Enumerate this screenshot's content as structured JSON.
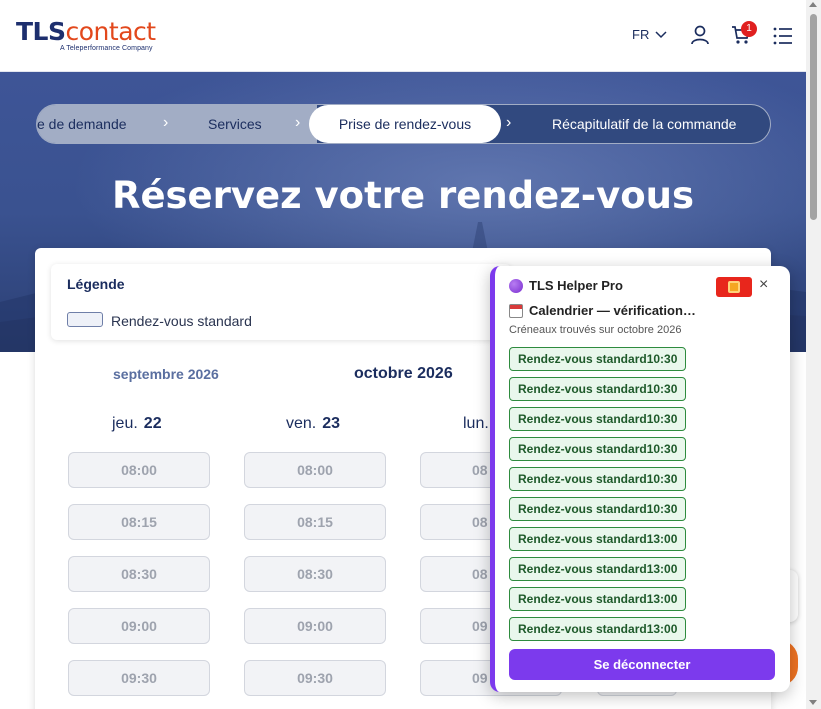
{
  "header": {
    "logo_tls": "TLS",
    "logo_contact": "contact",
    "logo_sub": "A Teleperformance Company",
    "language": "FR",
    "cart_count": "1"
  },
  "steps": {
    "items": [
      "e de demande",
      "Services",
      "Prise de rendez-vous",
      "Récapitulatif de la commande"
    ],
    "separator": "›",
    "active_index": 2
  },
  "hero": {
    "title": "Réservez votre rendez-vous"
  },
  "legend": {
    "title": "Légende",
    "standard_label": "Rendez-vous standard"
  },
  "calendar": {
    "prev_month": "septembre 2026",
    "current_month": "octobre 2026",
    "days": [
      {
        "name": "jeu.",
        "num": "22"
      },
      {
        "name": "ven.",
        "num": "23"
      },
      {
        "name": "lun.",
        "num": ""
      }
    ],
    "times": [
      "08:00",
      "08:15",
      "08:30",
      "09:00",
      "09:30"
    ],
    "partial_times": [
      "08",
      "08",
      "08",
      "09",
      "09"
    ]
  },
  "panel": {
    "title": "TLS Helper Pro",
    "close": "×",
    "subtitle": "Calendrier — vérification…",
    "info": "Créneaux trouvés sur octobre 2026",
    "slots": [
      "Rendez-vous standard10:30",
      "Rendez-vous standard10:30",
      "Rendez-vous standard10:30",
      "Rendez-vous standard10:30",
      "Rendez-vous standard10:30",
      "Rendez-vous standard10:30",
      "Rendez-vous standard13:00",
      "Rendez-vous standard13:00",
      "Rendez-vous standard13:00",
      "Rendez-vous standard13:00"
    ],
    "logout": "Se déconnecter"
  },
  "colors": {
    "brand_blue": "#1d2f6e",
    "brand_orange": "#e2481c",
    "helper_purple": "#7c3aed",
    "slot_green": "#2e8b3e"
  }
}
